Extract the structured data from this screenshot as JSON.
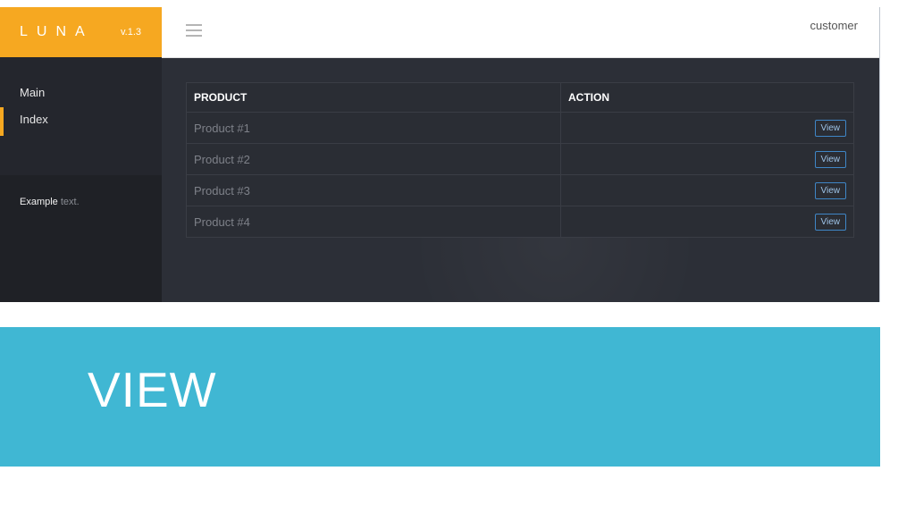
{
  "brand": {
    "name": "LUNA",
    "version": "v.1.3"
  },
  "header": {
    "user": "customer"
  },
  "sidebar": {
    "items": [
      {
        "label": "Main"
      },
      {
        "label": "Index"
      }
    ],
    "example": {
      "bold": "Example",
      "muted": "text."
    }
  },
  "table": {
    "headers": [
      "PRODUCT",
      "ACTION"
    ],
    "rows": [
      {
        "product": "Product #1",
        "action": "View"
      },
      {
        "product": "Product #2",
        "action": "View"
      },
      {
        "product": "Product #3",
        "action": "View"
      },
      {
        "product": "Product #4",
        "action": "View"
      }
    ]
  },
  "banner": {
    "title": "VIEW"
  },
  "colors": {
    "accent": "#f6a821",
    "banner": "#40b7d3",
    "sidebar": "#24262d",
    "content": "#2c2f37"
  }
}
